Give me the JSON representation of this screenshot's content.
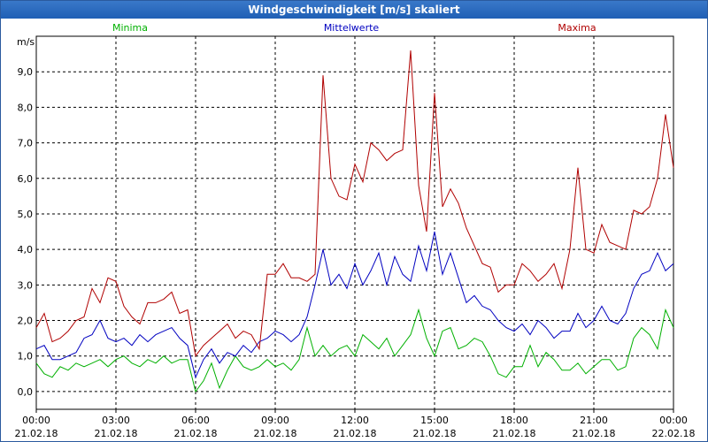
{
  "window": {
    "title": "Windgeschwindigkeit [m/s] skaliert"
  },
  "chart_data": {
    "type": "line",
    "title": "Windgeschwindigkeit [m/s] skaliert",
    "ylabel": "m/s",
    "ylim": [
      -0.5,
      10.0
    ],
    "yticks": [
      0,
      1,
      2,
      3,
      4,
      5,
      6,
      7,
      8,
      9
    ],
    "ytick_labels": [
      "0,0",
      "1,0",
      "2,0",
      "3,0",
      "4,0",
      "5,0",
      "6,0",
      "7,0",
      "8,0",
      "9,0"
    ],
    "xlim": [
      0,
      24
    ],
    "xticks": [
      0,
      3,
      6,
      9,
      12,
      15,
      18,
      21,
      24
    ],
    "xtick_labels": [
      [
        "00:00",
        "21.02.18"
      ],
      [
        "03:00",
        "21.02.18"
      ],
      [
        "06:00",
        "21.02.18"
      ],
      [
        "09:00",
        "21.02.18"
      ],
      [
        "12:00",
        "21.02.18"
      ],
      [
        "15:00",
        "21.02.18"
      ],
      [
        "18:00",
        "21.02.18"
      ],
      [
        "21:00",
        "21.02.18"
      ],
      [
        "00:00",
        "22.02.18"
      ]
    ],
    "grid": true,
    "series": [
      {
        "name": "Minima",
        "color": "#00b000",
        "x": [
          0.0,
          0.3,
          0.6,
          0.9,
          1.2,
          1.5,
          1.8,
          2.1,
          2.4,
          2.7,
          3.0,
          3.3,
          3.6,
          3.9,
          4.2,
          4.5,
          4.8,
          5.1,
          5.4,
          5.7,
          6.0,
          6.3,
          6.6,
          6.9,
          7.2,
          7.5,
          7.8,
          8.1,
          8.4,
          8.7,
          9.0,
          9.3,
          9.6,
          9.9,
          10.2,
          10.5,
          10.8,
          11.1,
          11.4,
          11.7,
          12.0,
          12.3,
          12.6,
          12.9,
          13.2,
          13.5,
          13.8,
          14.1,
          14.4,
          14.7,
          15.0,
          15.3,
          15.6,
          15.9,
          16.2,
          16.5,
          16.8,
          17.1,
          17.4,
          17.7,
          18.0,
          18.3,
          18.6,
          18.9,
          19.2,
          19.5,
          19.8,
          20.1,
          20.4,
          20.7,
          21.0,
          21.3,
          21.6,
          21.9,
          22.2,
          22.5,
          22.8,
          23.1,
          23.4,
          23.7,
          24.0
        ],
        "values": [
          0.8,
          0.5,
          0.4,
          0.7,
          0.6,
          0.8,
          0.7,
          0.8,
          0.9,
          0.7,
          0.9,
          1.0,
          0.8,
          0.7,
          0.9,
          0.8,
          1.0,
          0.8,
          0.9,
          0.9,
          0.0,
          0.3,
          0.8,
          0.1,
          0.6,
          1.0,
          0.7,
          0.6,
          0.7,
          0.9,
          0.7,
          0.8,
          0.6,
          0.9,
          1.8,
          1.0,
          1.3,
          1.0,
          1.2,
          1.3,
          1.0,
          1.6,
          1.4,
          1.2,
          1.5,
          1.0,
          1.3,
          1.6,
          2.3,
          1.5,
          1.0,
          1.7,
          1.8,
          1.2,
          1.3,
          1.5,
          1.4,
          1.0,
          0.5,
          0.4,
          0.7,
          0.7,
          1.3,
          0.7,
          1.1,
          0.9,
          0.6,
          0.6,
          0.8,
          0.5,
          0.7,
          0.9,
          0.9,
          0.6,
          0.7,
          1.5,
          1.8,
          1.6,
          1.2,
          2.3,
          1.8
        ]
      },
      {
        "name": "Mittelwerte",
        "color": "#0000c0",
        "x": [
          0.0,
          0.3,
          0.6,
          0.9,
          1.2,
          1.5,
          1.8,
          2.1,
          2.4,
          2.7,
          3.0,
          3.3,
          3.6,
          3.9,
          4.2,
          4.5,
          4.8,
          5.1,
          5.4,
          5.7,
          6.0,
          6.3,
          6.6,
          6.9,
          7.2,
          7.5,
          7.8,
          8.1,
          8.4,
          8.7,
          9.0,
          9.3,
          9.6,
          9.9,
          10.2,
          10.5,
          10.8,
          11.1,
          11.4,
          11.7,
          12.0,
          12.3,
          12.6,
          12.9,
          13.2,
          13.5,
          13.8,
          14.1,
          14.4,
          14.7,
          15.0,
          15.3,
          15.6,
          15.9,
          16.2,
          16.5,
          16.8,
          17.1,
          17.4,
          17.7,
          18.0,
          18.3,
          18.6,
          18.9,
          19.2,
          19.5,
          19.8,
          20.1,
          20.4,
          20.7,
          21.0,
          21.3,
          21.6,
          21.9,
          22.2,
          22.5,
          22.8,
          23.1,
          23.4,
          23.7,
          24.0
        ],
        "values": [
          1.2,
          1.3,
          0.9,
          0.9,
          1.0,
          1.1,
          1.5,
          1.6,
          2.0,
          1.5,
          1.4,
          1.5,
          1.3,
          1.6,
          1.4,
          1.6,
          1.7,
          1.8,
          1.5,
          1.3,
          0.4,
          0.9,
          1.2,
          0.8,
          1.1,
          1.0,
          1.3,
          1.1,
          1.4,
          1.5,
          1.7,
          1.6,
          1.4,
          1.6,
          2.1,
          3.0,
          4.0,
          3.0,
          3.3,
          2.9,
          3.6,
          3.0,
          3.4,
          3.9,
          3.0,
          3.8,
          3.3,
          3.1,
          4.1,
          3.4,
          4.5,
          3.3,
          3.9,
          3.2,
          2.5,
          2.7,
          2.4,
          2.3,
          2.0,
          1.8,
          1.7,
          1.9,
          1.6,
          2.0,
          1.8,
          1.5,
          1.7,
          1.7,
          2.2,
          1.8,
          2.0,
          2.4,
          2.0,
          1.9,
          2.2,
          2.9,
          3.3,
          3.4,
          3.9,
          3.4,
          3.6
        ]
      },
      {
        "name": "Maxima",
        "color": "#b00000",
        "x": [
          0.0,
          0.3,
          0.6,
          0.9,
          1.2,
          1.5,
          1.8,
          2.1,
          2.4,
          2.7,
          3.0,
          3.3,
          3.6,
          3.9,
          4.2,
          4.5,
          4.8,
          5.1,
          5.4,
          5.7,
          6.0,
          6.3,
          6.6,
          6.9,
          7.2,
          7.5,
          7.8,
          8.1,
          8.4,
          8.7,
          9.0,
          9.3,
          9.6,
          9.9,
          10.2,
          10.5,
          10.8,
          11.1,
          11.4,
          11.7,
          12.0,
          12.3,
          12.6,
          12.9,
          13.2,
          13.5,
          13.8,
          14.1,
          14.4,
          14.7,
          15.0,
          15.3,
          15.6,
          15.9,
          16.2,
          16.5,
          16.8,
          17.1,
          17.4,
          17.7,
          18.0,
          18.3,
          18.6,
          18.9,
          19.2,
          19.5,
          19.8,
          20.1,
          20.4,
          20.7,
          21.0,
          21.3,
          21.6,
          21.9,
          22.2,
          22.5,
          22.8,
          23.1,
          23.4,
          23.7,
          24.0
        ],
        "values": [
          1.8,
          2.2,
          1.4,
          1.5,
          1.7,
          2.0,
          2.1,
          2.9,
          2.5,
          3.2,
          3.1,
          2.4,
          2.1,
          1.9,
          2.5,
          2.5,
          2.6,
          2.8,
          2.2,
          2.3,
          1.0,
          1.3,
          1.5,
          1.7,
          1.9,
          1.5,
          1.7,
          1.6,
          1.2,
          3.3,
          3.3,
          3.6,
          3.2,
          3.2,
          3.1,
          3.3,
          8.9,
          6.0,
          5.5,
          5.4,
          6.4,
          5.9,
          7.0,
          6.8,
          6.5,
          6.7,
          6.8,
          9.6,
          5.8,
          4.5,
          8.4,
          5.2,
          5.7,
          5.3,
          4.6,
          4.1,
          3.6,
          3.5,
          2.8,
          3.0,
          3.0,
          3.6,
          3.4,
          3.1,
          3.3,
          3.6,
          2.9,
          4.0,
          6.3,
          4.0,
          3.9,
          4.7,
          4.2,
          4.1,
          4.0,
          5.1,
          5.0,
          5.2,
          6.0,
          7.8,
          6.3
        ]
      }
    ]
  }
}
